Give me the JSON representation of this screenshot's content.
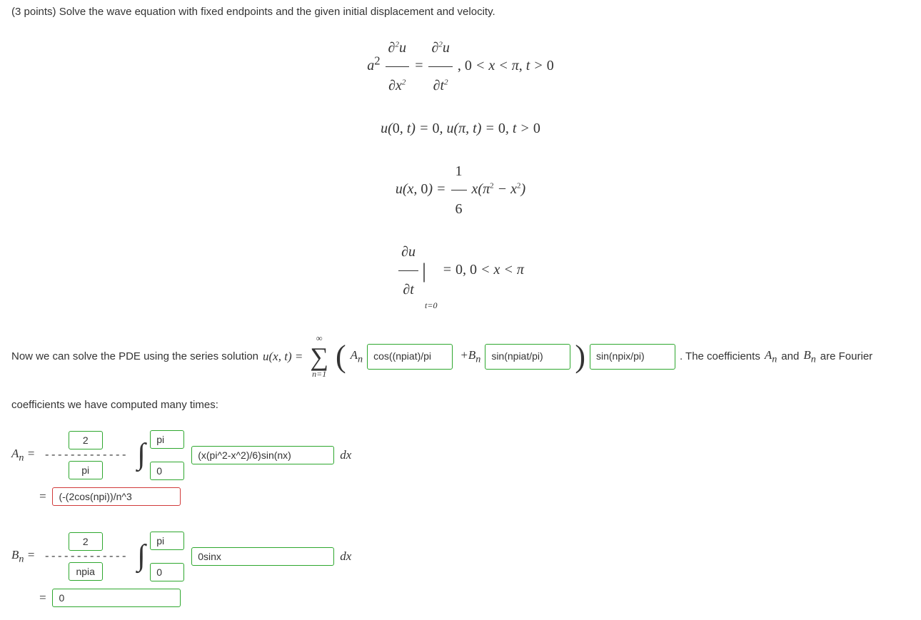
{
  "problem": {
    "points_label": "(3 points) Solve the wave equation with fixed endpoints and the given initial displacement and velocity.",
    "eq1": "a² ∂²u/∂x² = ∂²u/∂t² , 0 < x < π, t > 0",
    "eq2": "u(0, t) = 0, u(π, t) = 0, t > 0",
    "eq3": "u(x, 0) = (1/6) x(π² − x²)",
    "eq4": "∂u/∂t |_{t=0} = 0, 0 < x < π"
  },
  "narrative": {
    "part1": "Now we can solve the PDE using the series solution ",
    "series_lhs": "u(x, t) = ",
    "sum_upper": "∞",
    "sum_lower": "n=1",
    "An_label": "Aₙ",
    "cos_arg": "cos((npiat)/pi",
    "plus_Bn": " +Bₙ",
    "sin_arg": "sin(npiat/pi)",
    "outer_sin": "sin(npix/pi)",
    "part2": ". The coefficients ",
    "A_symbol": "Aₙ",
    "and_text": " and ",
    "B_symbol": "Bₙ",
    "part3": " are Fourier",
    "part4": "coefficients we have computed many times:"
  },
  "An": {
    "lhs": "Aₙ = ",
    "frac_num": "2",
    "frac_den": "pi",
    "int_upper": "pi",
    "int_lower": "0",
    "integrand": "(x(pi^2-x^2)/6)sin(nx)",
    "dx": "dx",
    "equals": "= ",
    "result": "(-(2cos(npi))/n^3"
  },
  "Bn": {
    "lhs": "Bₙ = ",
    "frac_num": "2",
    "frac_den": "npia",
    "int_upper": "pi",
    "int_lower": "0",
    "integrand": "0sinx",
    "dx": "dx",
    "equals": "= ",
    "result": "0"
  }
}
